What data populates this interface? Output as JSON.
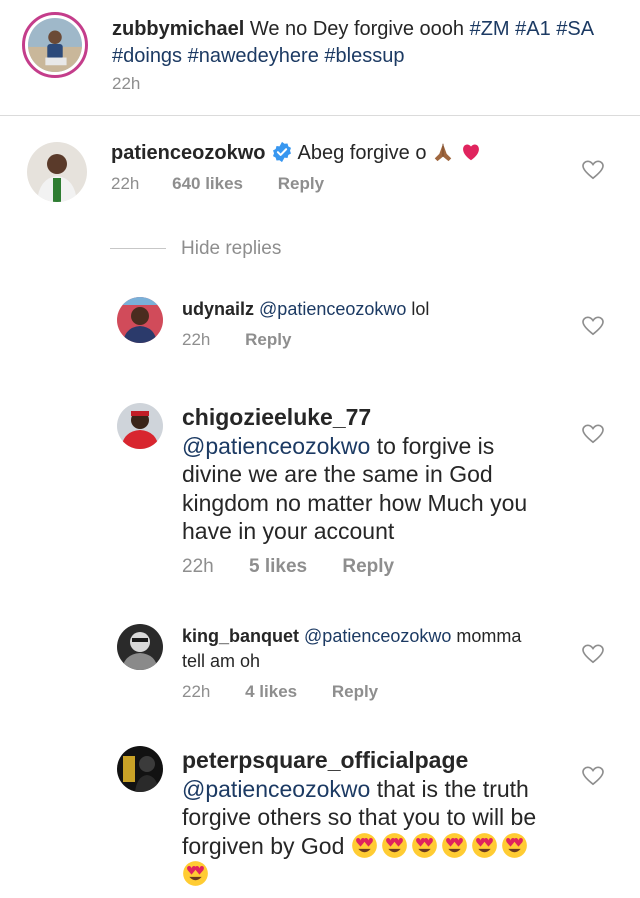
{
  "caption": {
    "username": "zubbymichael",
    "text": "We no Dey forgive oooh",
    "hashtags_line1": "#ZM #A1 #SA",
    "hashtags_line2": "#doings #nawedeyhere #blessup",
    "time": "22h"
  },
  "top_comment": {
    "username": "patienceozokwo",
    "verified": true,
    "text": "Abeg forgive o",
    "emoji": [
      "folded-hands",
      "red-heart"
    ],
    "time": "22h",
    "likes": "640 likes",
    "reply": "Reply",
    "hide_replies": "Hide replies"
  },
  "replies": [
    {
      "username": "udynailz",
      "mention": "@patienceozokwo",
      "text": "lol",
      "time": "22h",
      "likes": "",
      "reply": "Reply"
    },
    {
      "username": "chigozieeluke_77",
      "mention": "@patienceozokwo",
      "text_line1": "to forgive is",
      "text_line2": "divine we are the same in God",
      "text_line3": "kingdom no matter how Much you",
      "text_line4": "have in your account",
      "time": "22h",
      "likes": "5 likes",
      "reply": "Reply"
    },
    {
      "username": "king_banquet",
      "mention": "@patienceozokwo",
      "text_line1": "momma",
      "text_line2": "tell am oh",
      "time": "22h",
      "likes": "4 likes",
      "reply": "Reply"
    },
    {
      "username": "peterpsquare_officialpage",
      "mention": "@patienceozokwo",
      "text_line1": "that is the truth",
      "text_line2": "forgive others so that you to will be",
      "text_line3": "forgiven by God",
      "emoji": [
        "heart-eyes",
        "heart-eyes",
        "heart-eyes",
        "heart-eyes",
        "heart-eyes",
        "heart-eyes",
        "heart-eyes"
      ]
    }
  ],
  "colors": {
    "text": "#262626",
    "mention": "#1c3a63",
    "meta": "#8e8e8e",
    "divider": "#dbdbdb",
    "verified": "#3897f0",
    "emoji_heart": "#e0245e"
  }
}
